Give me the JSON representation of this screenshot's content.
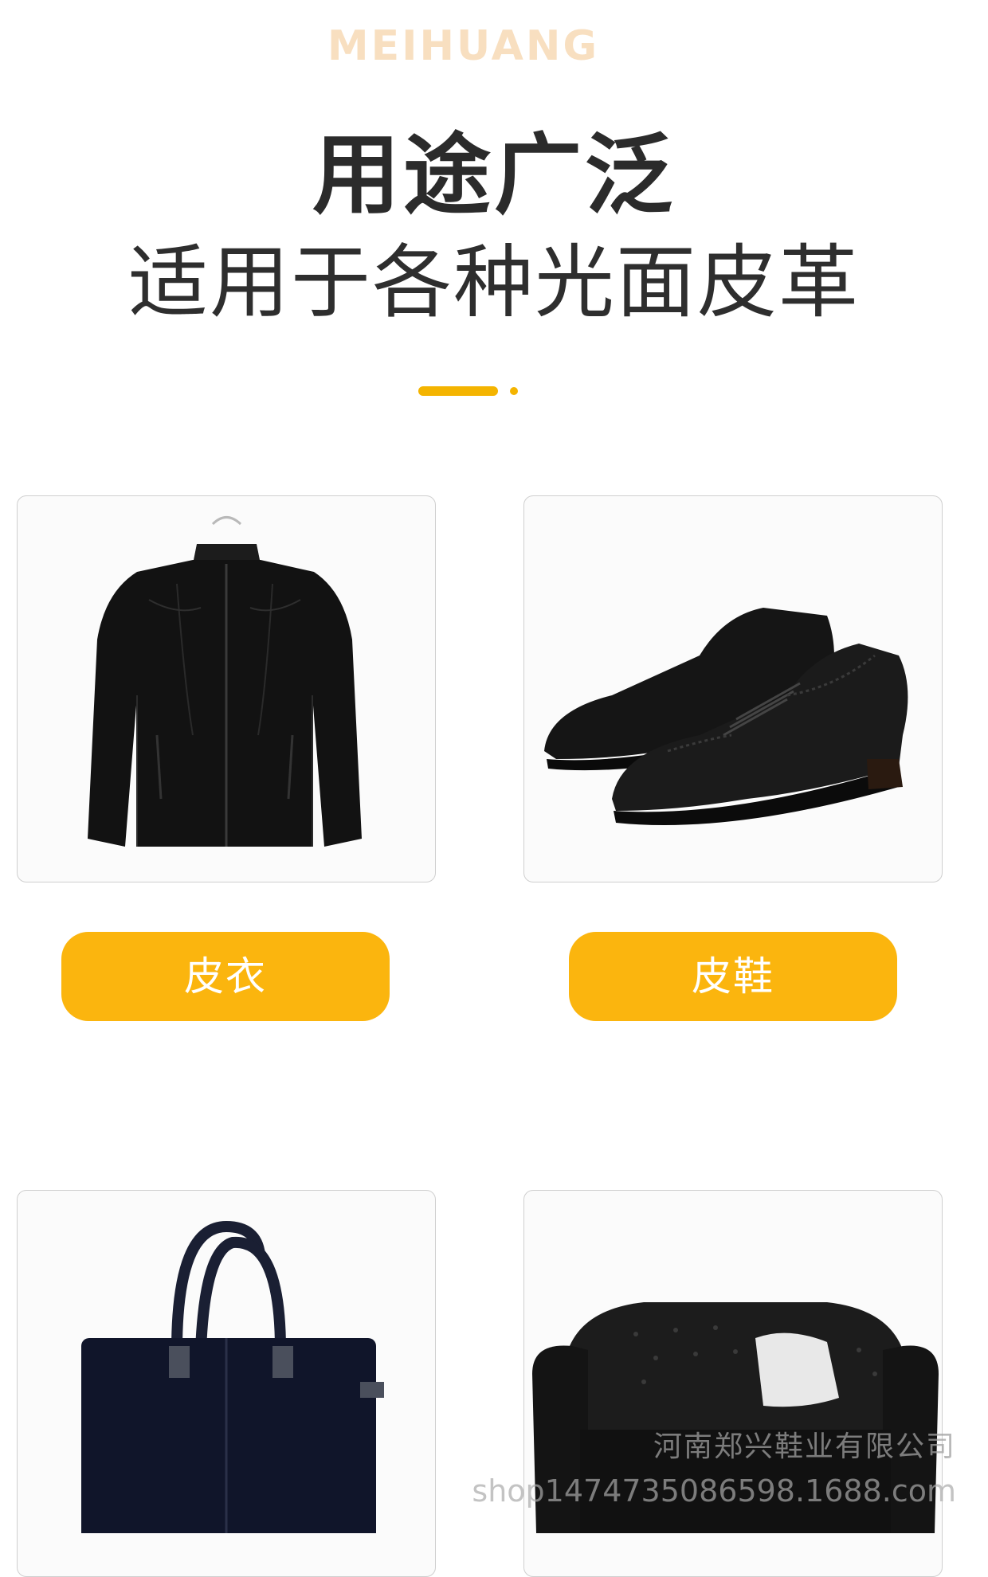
{
  "header": {
    "brand": "MEIHUANG",
    "headline": "用途广泛",
    "subline": "适用于各种光面皮革"
  },
  "colors": {
    "accent": "#fbb50e",
    "brand_text": "#f8dfc0",
    "heading": "#2b2b2b"
  },
  "products": [
    {
      "label": "皮衣",
      "icon": "leather-jacket-image"
    },
    {
      "label": "皮鞋",
      "icon": "leather-shoes-image"
    },
    {
      "icon": "leather-handbag-image"
    },
    {
      "icon": "leather-sofa-image"
    }
  ],
  "watermark": {
    "company": "河南郑兴鞋业有限公司",
    "shop": "shop1474735086598.1688.com"
  }
}
